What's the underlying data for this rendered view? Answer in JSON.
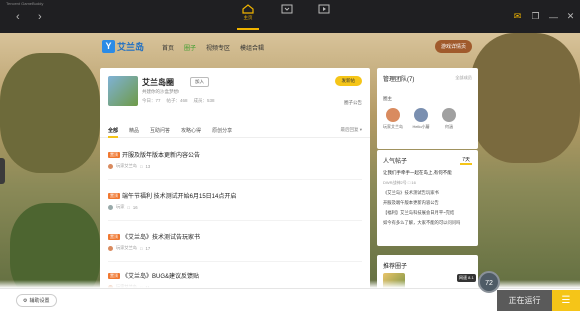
{
  "titlebar": {
    "app_name": "Tencent GameBuddy",
    "tabs": [
      {
        "label": "主页",
        "icon": "home-icon",
        "active": true
      },
      {
        "label": "",
        "icon": "download-icon",
        "active": false
      },
      {
        "label": "",
        "icon": "video-icon",
        "active": false
      }
    ]
  },
  "site": {
    "logo_letter": "Y",
    "logo_name": "艾兰岛",
    "nav": [
      "首页",
      "圈子",
      "视频专区",
      "模组合辑"
    ],
    "active_nav": "圈子",
    "enter_game": "游戏详情页"
  },
  "circle": {
    "name": "艾兰岛圈",
    "join_label": "加入",
    "desc": "共建你的沙盒梦想!",
    "stats": [
      "今日：77",
      "帖子：468",
      "成员：538"
    ],
    "post_button": "发新帖",
    "admin_link": "圈子公告"
  },
  "tabs": {
    "items": [
      "全部",
      "精品",
      "互助问答",
      "攻略心得",
      "原创分享"
    ],
    "active": "全部",
    "sort": "最后回复"
  },
  "posts": [
    {
      "tag": "置顶",
      "title": "开服及版年版本更新内容公告",
      "author": "玩家艾兰岛",
      "time": "",
      "comments": "13"
    },
    {
      "tag": "置顶",
      "title": "端午节福利 技术测试开始6月15日14点开启",
      "author": "玩家",
      "time": "",
      "comments": "16"
    },
    {
      "tag": "置顶",
      "title": "《艾兰岛》技术测试告玩家书",
      "author": "玩家艾兰岛",
      "time": "",
      "comments": "17"
    },
    {
      "tag": "置顶",
      "title": "《艾兰岛》BUG&建议反馈贴",
      "author": "玩家艾兰岛",
      "time": "",
      "comments": "11"
    }
  ],
  "team": {
    "title": "管理团队(7)",
    "more": "全部成员",
    "role": "圈主",
    "members": [
      {
        "name": "玩家艾兰岛",
        "color": "#d98b5f"
      },
      {
        "name": "Hello小蘑",
        "color": "#7a8fb0"
      },
      {
        "name": "何涵",
        "color": "#a0a0a0"
      }
    ]
  },
  "hot": {
    "title": "人气帖子",
    "period": "7天",
    "first": "让我们手牵手一起在岛上,有何不能",
    "first_author": "DWR战神2号",
    "first_comments": "16",
    "items": [
      "《艾兰岛》技术测试告玩家书",
      "开服及端午版本更新内容公告",
      "【福利】艾兰岛科技展会日月平~完结",
      "如今有多么了解，大家不能的可以问问吗"
    ]
  },
  "fav": {
    "title": "推荐圈子"
  },
  "bottom": {
    "assist": "辅助设置",
    "running": "正在运行",
    "speed": "72",
    "speed_tip": "网速 8.1"
  },
  "colors": {
    "accent": "#f5c518",
    "brand_blue": "#1e6fc4",
    "tag_orange": "#f07830",
    "nav_active": "#3a9d2b"
  }
}
